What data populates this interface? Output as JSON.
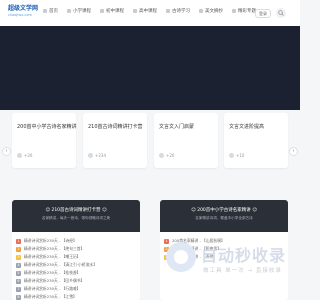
{
  "header": {
    "logo_line1": "超级文学网",
    "logo_line2": "chaojiwx.com",
    "nav": [
      {
        "label": "首页",
        "icon": "home-icon"
      },
      {
        "label": "小学课程",
        "icon": "book-icon"
      },
      {
        "label": "初中课程",
        "icon": "book-icon"
      },
      {
        "label": "高中课程",
        "icon": "book-icon"
      },
      {
        "label": "古诗学习",
        "icon": "book-icon"
      },
      {
        "label": "美文摘抄",
        "icon": "book-icon"
      },
      {
        "label": "精彩专题",
        "icon": "book-icon"
      }
    ],
    "login_label": "登录"
  },
  "cards": [
    {
      "title": "200首中小学古诗名家精讲",
      "count": "+26"
    },
    {
      "title": "210首古诗词精讲打卡营",
      "count": "+234"
    },
    {
      "title": "文言文入门启蒙",
      "count": "+20"
    },
    {
      "title": "文言文进阶提高",
      "count": "+10"
    }
  ],
  "panels": [
    {
      "title": "☺ 210首古诗词精讲打卡营 ☺",
      "desc": "名家精讲，每天一首诗，带你领略诗词之美",
      "items": [
        {
          "num": "1",
          "text": "精讲诗词赏析230天 - 【诗经】",
          "color": "#e86c5a"
        },
        {
          "num": "2",
          "text": "精讲诗词赏析230天 - 【绝句三首】",
          "color": "#f0a040"
        },
        {
          "num": "3",
          "text": "精讲诗词赏析230天 - 【嘲王历】",
          "color": "#f3c240"
        },
        {
          "num": "4",
          "text": "精讲诗词赏析230天 - 【清江引·小桥流水】",
          "color": "#9aa3ad"
        },
        {
          "num": "5",
          "text": "精讲诗词赏析230天 - 【桂枝香】",
          "color": "#9aa3ad"
        },
        {
          "num": "6",
          "text": "精讲诗词赏析230天 - 【回乡偶书】",
          "color": "#9aa3ad"
        },
        {
          "num": "7",
          "text": "精讲诗词赏析230天 - 【行路难】",
          "color": "#9aa3ad"
        },
        {
          "num": "8",
          "text": "精讲诗词赏析230天 - 【江雪】",
          "color": "#9aa3ad"
        }
      ]
    },
    {
      "title": "☺ 200首中小学古诗名家精讲 ☺",
      "desc": "名家精讲诗词，覆盖中小学全部古诗",
      "items": [
        {
          "num": "1",
          "text": "200首名家精讲 - 【山居秋暝】",
          "color": "#e86c5a"
        },
        {
          "num": "2",
          "text": "200首名家精讲 - 【静夜思】",
          "color": "#f0a040"
        },
        {
          "num": "3",
          "text": "200首名家精讲 - 【春晓】",
          "color": "#f3c240"
        }
      ]
    }
  ],
  "watermark": {
    "title": "自动秒收录",
    "subtitle": "做工具 单一次 → 直接收录"
  },
  "arrows": {
    "left": "‹",
    "right": "›"
  }
}
